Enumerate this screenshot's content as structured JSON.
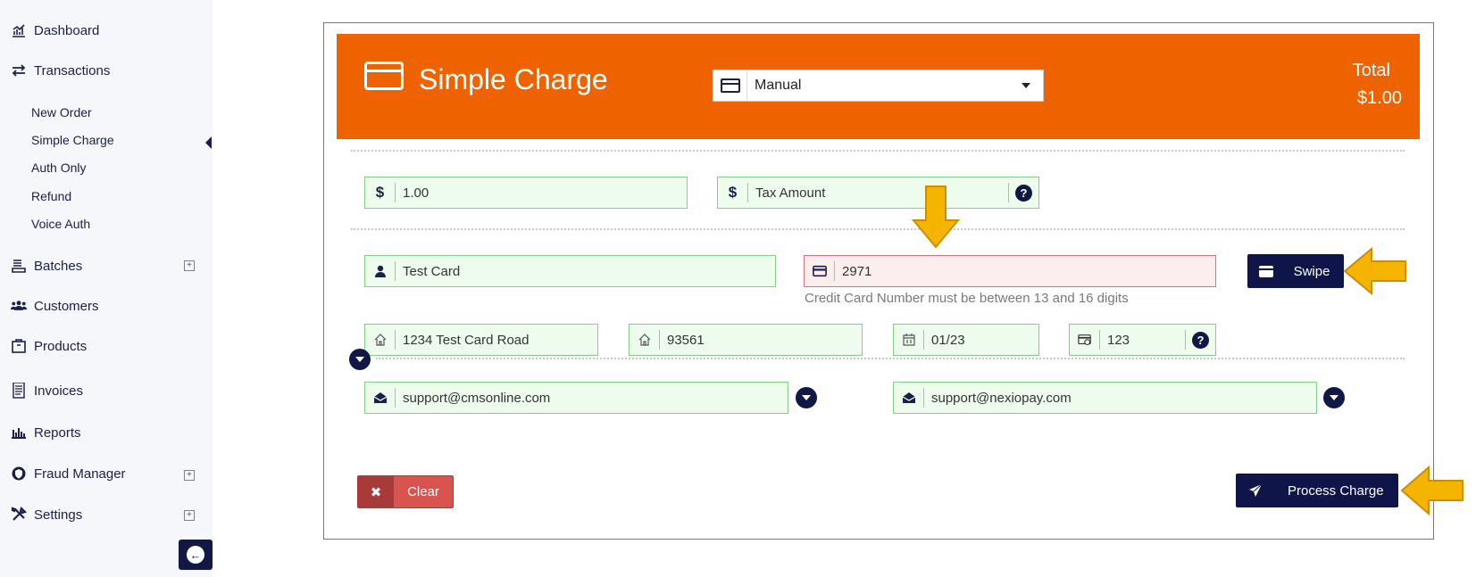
{
  "sidebar": {
    "items": [
      {
        "label": "Dashboard",
        "icon": "chart-line-icon"
      },
      {
        "label": "Transactions",
        "icon": "exchange-arrows-icon"
      },
      {
        "label": "Batches",
        "icon": "stack-icon"
      },
      {
        "label": "Customers",
        "icon": "users-icon"
      },
      {
        "label": "Products",
        "icon": "box-icon"
      },
      {
        "label": "Invoices",
        "icon": "document-icon"
      },
      {
        "label": "Reports",
        "icon": "bar-chart-icon"
      },
      {
        "label": "Fraud Manager",
        "icon": "shield-icon"
      },
      {
        "label": "Settings",
        "icon": "tools-icon"
      }
    ],
    "transactions_sub": [
      "New Order",
      "Simple Charge",
      "Auth Only",
      "Refund",
      "Voice Auth"
    ],
    "active_sub": "Simple Charge"
  },
  "header": {
    "title": "Simple Charge",
    "method_selected": "Manual",
    "total_label": "Total",
    "total_value": "$1.00",
    "brand_color": "#ee6300"
  },
  "form": {
    "amount": {
      "icon_symbol": "$",
      "value": "1.00"
    },
    "tax": {
      "icon_symbol": "$",
      "placeholder": "Tax Amount"
    },
    "cardholder": {
      "value": "Test Card"
    },
    "card_number": {
      "value": "2971",
      "error": "Credit Card Number must be between 13 and 16 digits"
    },
    "address": {
      "value": "1234 Test Card Road"
    },
    "zip": {
      "value": "93561"
    },
    "expiry": {
      "value": "01/23"
    },
    "cvv": {
      "value": "123"
    },
    "email_from": {
      "value": "support@cmsonline.com"
    },
    "email_to": {
      "value": "support@nexiopay.com"
    }
  },
  "buttons": {
    "swipe": "Swipe",
    "clear": "Clear",
    "process": "Process Charge"
  },
  "colors": {
    "field_ok_bg": "#eefcee",
    "field_error_bg": "#fdeeee",
    "navy": "#0f1548",
    "danger": "#d9534f",
    "annotation_arrow": "#f5b400"
  }
}
